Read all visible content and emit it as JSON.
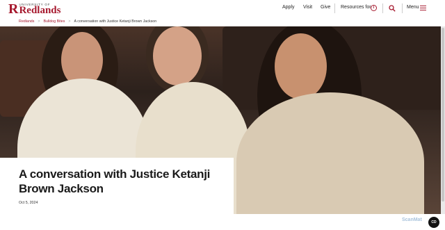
{
  "header": {
    "logo": {
      "mark": "R",
      "small": "University of",
      "big": "Redlands"
    },
    "nav": {
      "apply": "Apply",
      "visit": "Visit",
      "give": "Give",
      "resources": "Resources for",
      "menu": "Menu"
    },
    "icons": {
      "info": "info-icon",
      "search": "search-icon",
      "menu": "hamburger-icon"
    },
    "accent": "#a6192e"
  },
  "breadcrumb": {
    "items": [
      "Redlands",
      "Bulldog Bites",
      "A conversation with Justice Ketanji Brown Jackson"
    ],
    "separator": ">"
  },
  "article": {
    "title": "A conversation with Justice Ketanji Brown Jackson",
    "date": "Oct 5, 2024",
    "hero_image_alt": "hero-photo"
  },
  "overlay": {
    "watermark": "ScanMat",
    "cd_button": "CD"
  }
}
